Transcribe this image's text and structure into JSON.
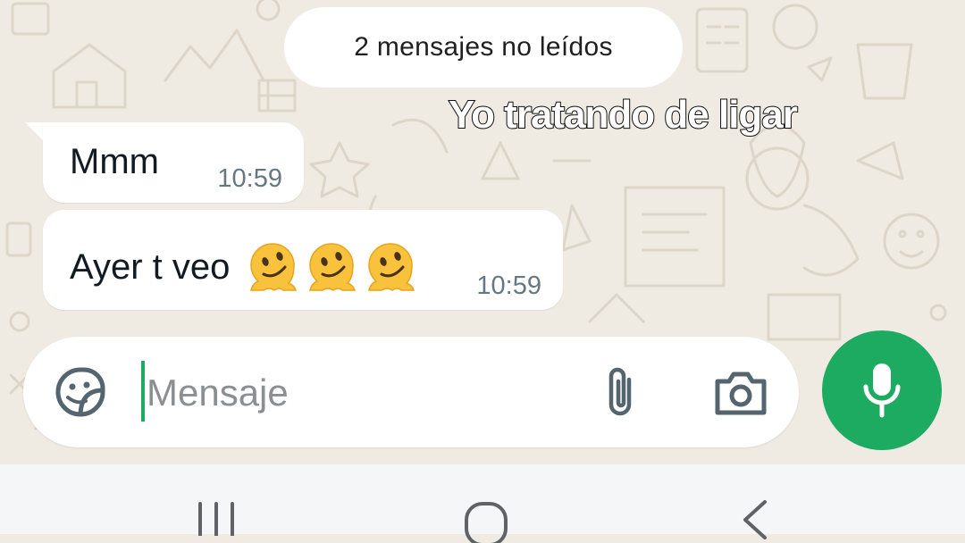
{
  "banner": {
    "unread": "2 mensajes no leídos"
  },
  "overlay": {
    "caption": "Yo tratando de ligar"
  },
  "messages": [
    {
      "text": "Mmm",
      "time": "10:59"
    },
    {
      "text": "Ayer t veo",
      "time": "10:59",
      "emojis": [
        "melting-face-icon",
        "melting-face-icon",
        "melting-face-icon"
      ]
    }
  ],
  "composer": {
    "placeholder": "Mensaje",
    "icons": [
      "sticker-icon",
      "paperclip-icon",
      "camera-icon",
      "microphone-icon"
    ]
  },
  "navigation": {
    "icons": [
      "recents-icon",
      "home-icon",
      "back-icon"
    ]
  },
  "colors": {
    "chat_background": "#efeae2",
    "bubble": "#ffffff",
    "accent_green": "#1daa61",
    "timestamp": "#667781",
    "nav_bar": "#f4f6f8"
  }
}
